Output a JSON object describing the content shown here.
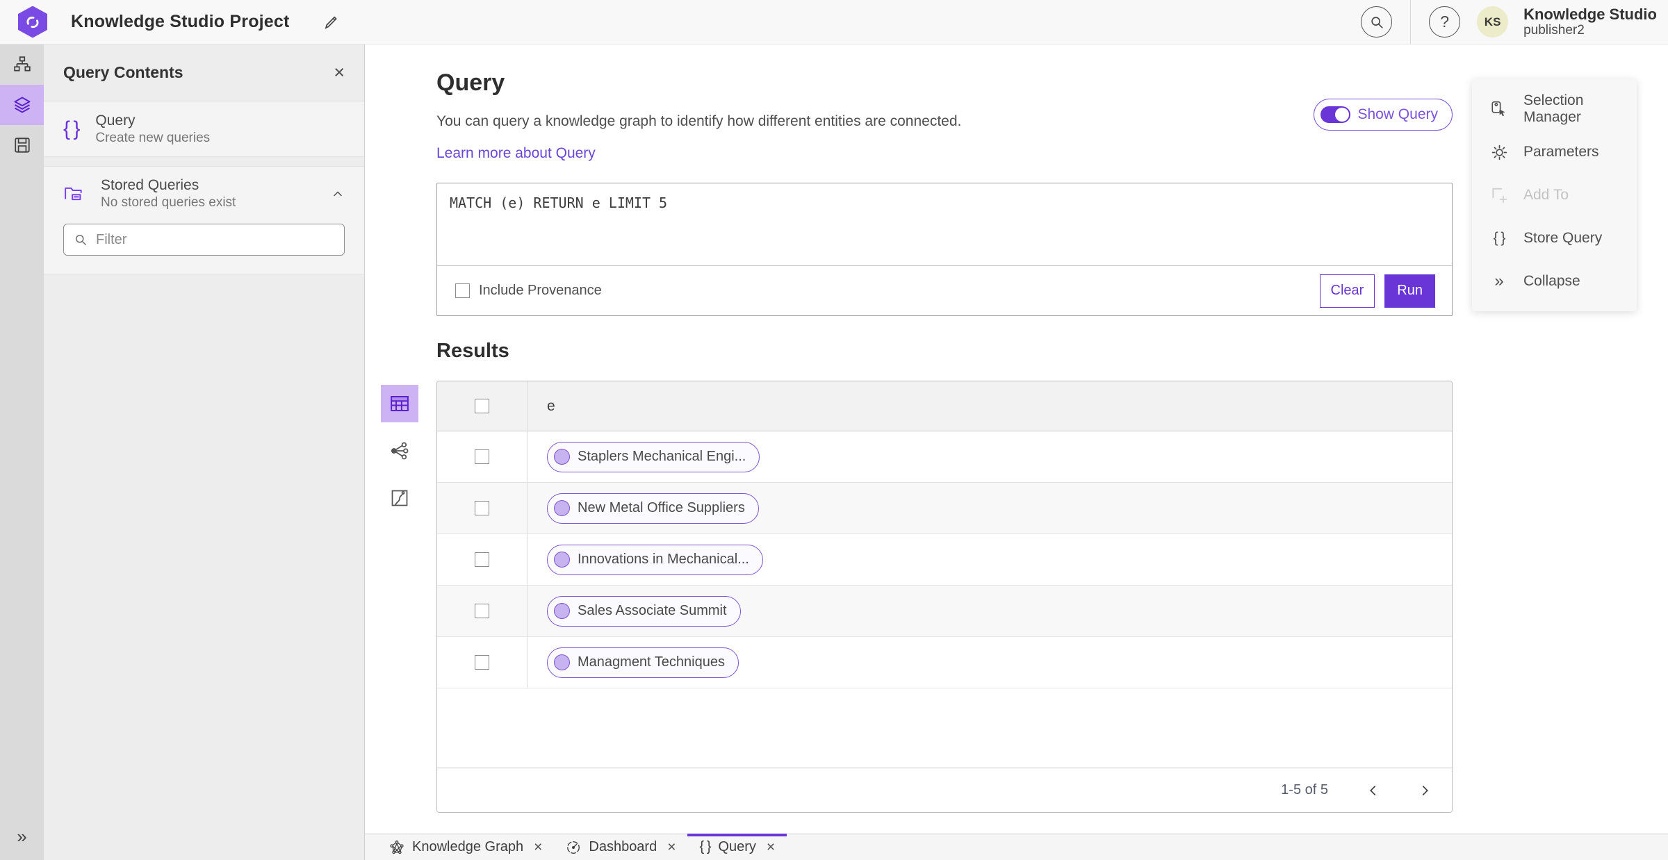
{
  "header": {
    "title": "Knowledge Studio Project",
    "user_org": "Knowledge Studio",
    "user_name": "publisher2",
    "avatar_initials": "KS"
  },
  "contents_panel": {
    "title": "Query Contents",
    "query_item": {
      "title": "Query",
      "subtitle": "Create new queries"
    },
    "stored_item": {
      "title": "Stored Queries",
      "subtitle": "No stored queries exist"
    },
    "filter_placeholder": "Filter"
  },
  "query_section": {
    "heading": "Query",
    "description": "You can query a knowledge graph to identify how different entities are connected.",
    "learn_more_label": "Learn more about Query",
    "show_query_label": "Show Query",
    "query_text": "MATCH (e) RETURN e LIMIT 5",
    "include_provenance_label": "Include Provenance",
    "clear_label": "Clear",
    "run_label": "Run"
  },
  "results_section": {
    "heading": "Results",
    "column_header": "e",
    "rows": [
      "Staplers Mechanical Engi...",
      "New Metal Office Suppliers",
      "Innovations in Mechanical...",
      "Sales Associate Summit",
      "Managment Techniques"
    ],
    "pagination_label": "1-5 of 5"
  },
  "context_menu": {
    "items": [
      {
        "label": "Selection Manager",
        "disabled": false
      },
      {
        "label": "Parameters",
        "disabled": false
      },
      {
        "label": "Add To",
        "disabled": true
      },
      {
        "label": "Store Query",
        "disabled": false
      },
      {
        "label": "Collapse",
        "disabled": false
      }
    ]
  },
  "tabs": [
    {
      "label": "Knowledge Graph",
      "active": false
    },
    {
      "label": "Dashboard",
      "active": false
    },
    {
      "label": "Query",
      "active": true
    }
  ],
  "glyphs": {
    "braces": "{ }",
    "close": "×",
    "collapse_chevrons": "»"
  },
  "colors": {
    "accent_purple": "#6a35d6",
    "accent_light": "#cdb3f3",
    "pill_fill": "#c7b3ef",
    "pill_border": "#7d55cf",
    "link_purple": "#6a46d8",
    "avatar_bg": "#edecca"
  }
}
